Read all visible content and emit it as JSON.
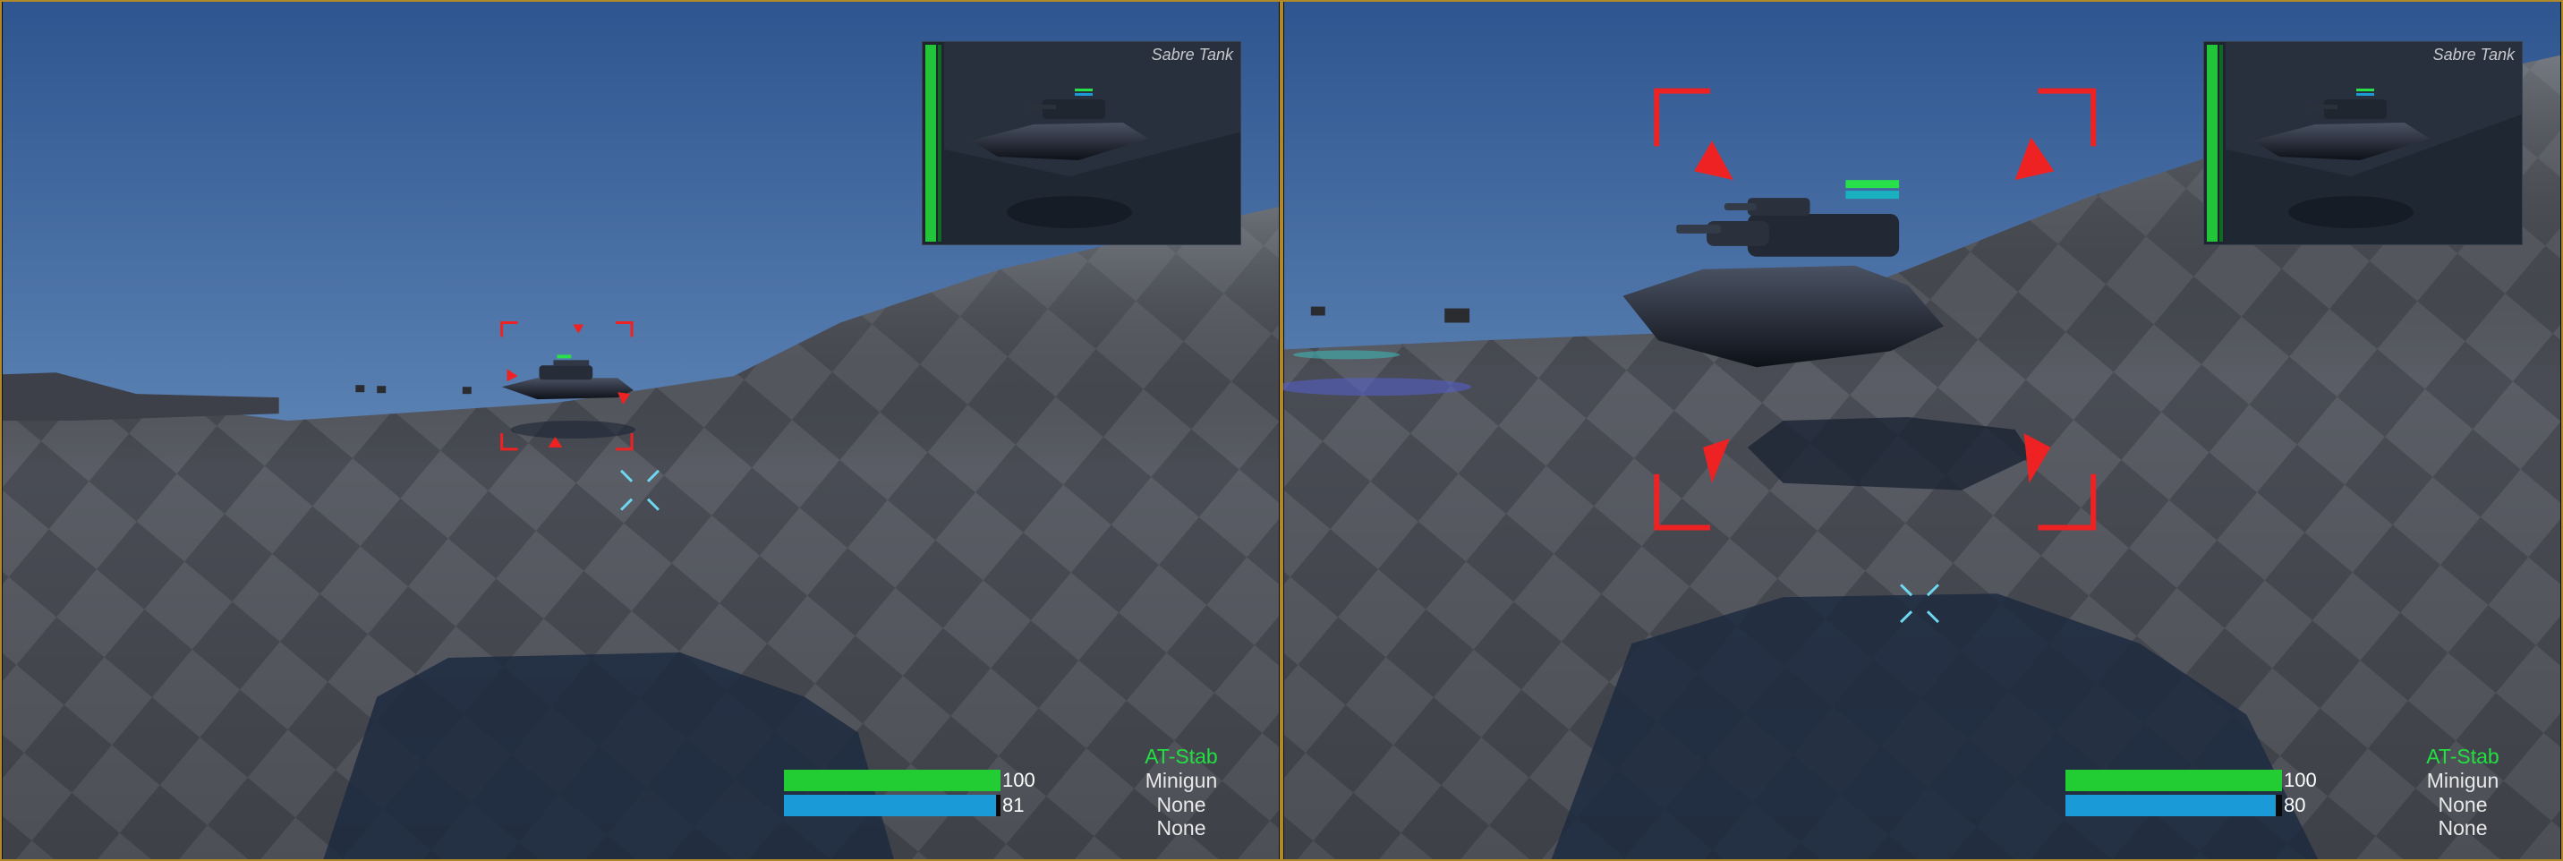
{
  "players": [
    {
      "target_name": "Sabre Tank",
      "health": 100,
      "energy": 81,
      "weapons": [
        {
          "label": "AT-Stab",
          "active": true
        },
        {
          "label": "Minigun",
          "active": false
        },
        {
          "label": "None",
          "active": false
        },
        {
          "label": "None",
          "active": false
        }
      ]
    },
    {
      "target_name": "Sabre Tank",
      "health": 100,
      "energy": 80,
      "weapons": [
        {
          "label": "AT-Stab",
          "active": true
        },
        {
          "label": "Minigun",
          "active": false
        },
        {
          "label": "None",
          "active": false
        },
        {
          "label": "None",
          "active": false
        }
      ]
    }
  ],
  "colors": {
    "health": "#22cc33",
    "energy": "#1a9ad6",
    "active_weapon": "#22e040",
    "lock_on": "#ee2222",
    "crosshair": "#6ed7f0",
    "viewport_border": "#b08a2a"
  }
}
